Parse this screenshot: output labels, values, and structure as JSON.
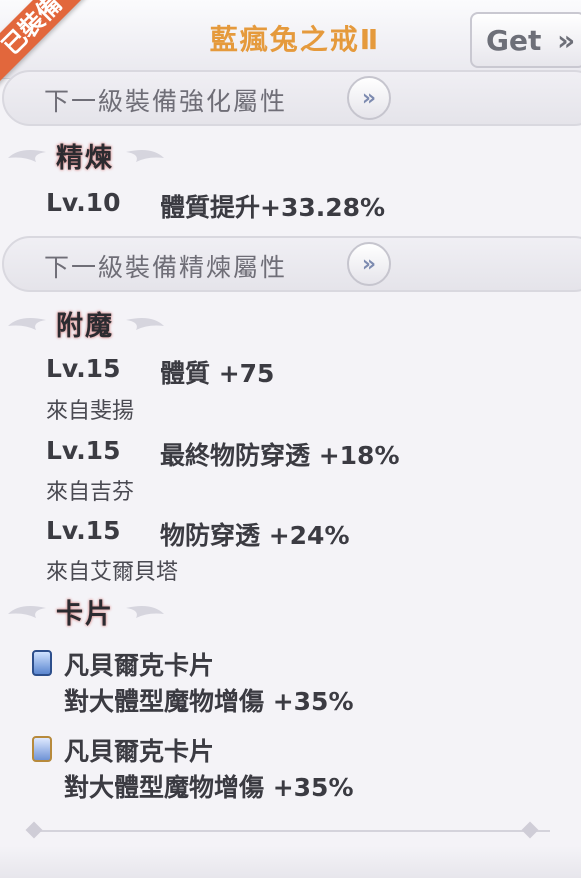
{
  "header": {
    "equipped_badge": "已裝備",
    "item_name": "藍瘋兔之戒Ⅱ",
    "get_label": "Get",
    "get_arrow": "»"
  },
  "enhance_next": {
    "label": "下一級裝備強化屬性",
    "arrow": "»"
  },
  "refine": {
    "title": "精煉",
    "level": "Lv.10",
    "stat": "體質提升+33.28%"
  },
  "refine_next": {
    "label": "下一級裝備精煉屬性",
    "arrow": "»"
  },
  "enchant": {
    "title": "附魔",
    "entries": [
      {
        "level": "Lv.15",
        "stat": "體質 +75",
        "source": "來自斐揚"
      },
      {
        "level": "Lv.15",
        "stat": "最終物防穿透 +18%",
        "source": "來自吉芬"
      },
      {
        "level": "Lv.15",
        "stat": "物防穿透 +24%",
        "source": "來自艾爾貝塔"
      }
    ]
  },
  "cards": {
    "title": "卡片",
    "entries": [
      {
        "name": "凡貝爾克卡片",
        "effect": "對大體型魔物增傷 +35%",
        "icon": "card-icon"
      },
      {
        "name": "凡貝爾克卡片",
        "effect": "對大體型魔物增傷 +35%",
        "icon": "card-icon-gold"
      }
    ]
  },
  "colors": {
    "badge": "#e2673c",
    "title": "#e59a3c",
    "arrow": "#7d8bb0"
  }
}
